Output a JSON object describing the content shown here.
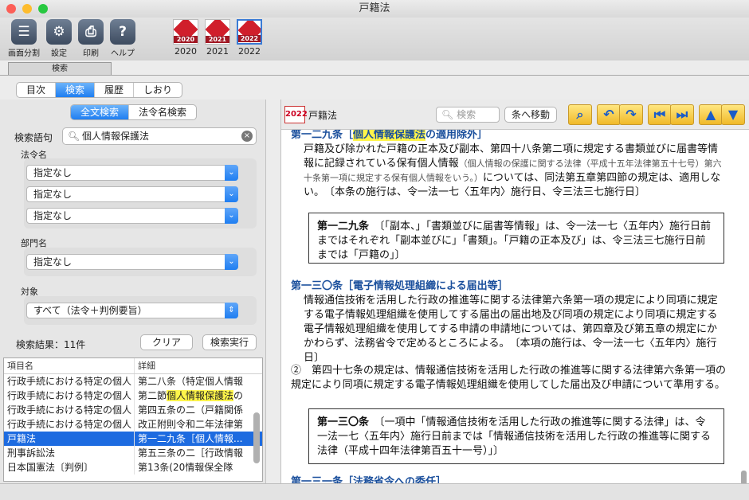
{
  "window": {
    "title": "戸籍法"
  },
  "toolbar": {
    "split": "画面分割",
    "settings": "設定",
    "print": "印刷",
    "help": "ヘルプ",
    "books": [
      {
        "year": "2020",
        "cover": "2020"
      },
      {
        "year": "2021",
        "cover": "2021"
      },
      {
        "year": "2022",
        "cover": "2022"
      }
    ]
  },
  "search_tab": "検索",
  "nav_tabs": [
    "目次",
    "検索",
    "履歴",
    "しおり"
  ],
  "search_mode": [
    "全文検索",
    "法令名検索"
  ],
  "form": {
    "query_label": "検索語句",
    "query_value": "個人情報保護法",
    "law_label": "法令名",
    "law_selects": [
      "指定なし",
      "指定なし",
      "指定なし"
    ],
    "dept_label": "部門名",
    "dept_select": "指定なし",
    "target_label": "対象",
    "target_select": "すべて（法令＋判例要旨）",
    "result_count": "検索結果：11件",
    "clear_btn": "クリア",
    "run_btn": "検索実行"
  },
  "results": {
    "headers": [
      "項目名",
      "詳細"
    ],
    "rows": [
      {
        "name": "行政手続における特定の個人",
        "detail": "第二八条（特定個人情報"
      },
      {
        "name": "行政手続における特定の個人",
        "detail_pre": "第二節",
        "detail_hl": "個人情報保護法",
        "detail_post": "の"
      },
      {
        "name": "行政手続における特定の個人",
        "detail": "第四五条の二（戸籍関係"
      },
      {
        "name": "行政手続における特定の個人",
        "detail": "改正附則令和二年法律第"
      },
      {
        "name": "戸籍法",
        "detail": "第一二九条［個人情報..."
      },
      {
        "name": "刑事訴訟法",
        "detail": "第五三条の二［行政情報"
      },
      {
        "name": "日本国憲法〔判例〕",
        "detail": "第13条(20情報保全隊"
      }
    ]
  },
  "main": {
    "year_badge": "2022",
    "law_title": "戸籍法",
    "search_placeholder": "検索",
    "goto_btn": "条へ移動",
    "a129_head_pre": "第一二九条［",
    "a129_head_hl": "個人情報保護法",
    "a129_head_post": "の適用除外］",
    "a129_body_1": "戸籍及び除かれた戸籍の正本及び副本、第四十八条第二項に規定する書類並びに届書等情報に記録されている保有個人情報",
    "a129_small": "（個人情報の保護に関する法律（平成十五年法律第五十七号）第六十条第一項に規定する保有個人情報をいう。）",
    "a129_body_2": "については、同法第五章第四節の規定は、適用しない。　〔本条の施行は、令一法一七〈五年内〉施行日、令三法三七施行日〕",
    "box1_head": "第一二九条",
    "box1_text": "〔「副本、」「書類並びに届書等情報」は、令一法一七〈五年内〉施行日前まではそれぞれ「副本並びに」「書類」。「戸籍の正本及び」は、令三法三七施行日前までは「戸籍の」〕",
    "a130_head": "第一三〇条［電子情報処理組織による届出等］",
    "a130_body": "情報通信技術を活用した行政の推進等に関する法律第六条第一項の規定により同項に規定する電子情報処理組織を使用してする届出の届出地及び同項の規定により同項に規定する電子情報処理組織を使用してする申請の申請地については、第四章及び第五章の規定にかかわらず、法務省令で定めるところによる。　〔本項の施行は、令一法一七〈五年内〉施行日〕",
    "a130_p2": "②　第四十七条の規定は、情報通信技術を活用した行政の推進等に関する法律第六条第一項の規定により同項に規定する電子情報処理組織を使用してした届出及び申請について準用する。",
    "box2_head": "第一三〇条",
    "box2_text": "〔一項中「情報通信技術を活用した行政の推進等に関する法律」は、令一法一七〈五年内〉施行日前までは「情報通信技術を活用した行政の推進等に関する法律（平成十四年法律第百五十一号）」〕",
    "a131_head": "第一三一条［法務省令への委任］"
  }
}
